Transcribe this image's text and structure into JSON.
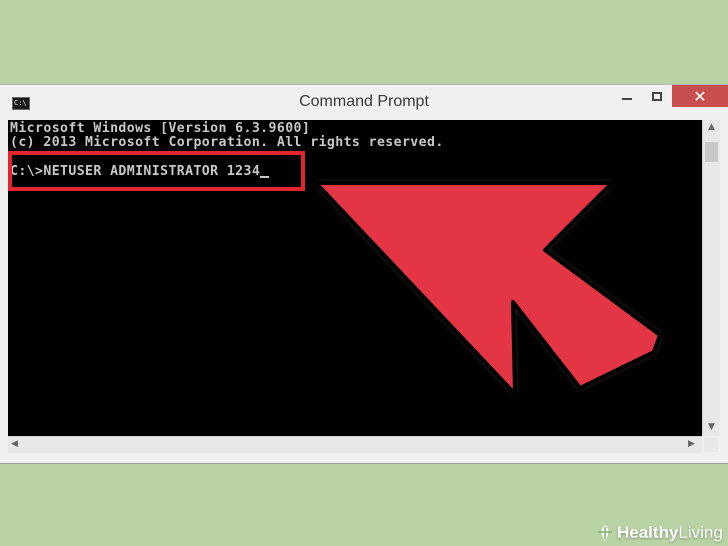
{
  "window": {
    "title": "Command Prompt",
    "icon": "cmd-icon",
    "icon_label": "C:\\",
    "minimize_icon": "minimize-icon",
    "maximize_icon": "maximize-icon",
    "close_icon": "close-icon",
    "close_glyph": "✕"
  },
  "console": {
    "line1": "Microsoft Windows [Version 6.3.9600]",
    "line2": "(c) 2013 Microsoft Corporation. All rights reserved.",
    "prompt": "C:\\>",
    "command": "NETUSER ADMINISTRATOR 1234"
  },
  "annotation": {
    "highlight_color": "#e3262e",
    "arrow_color": "#e33544",
    "arrow_icon": "pointer-arrow-icon"
  },
  "watermark": {
    "brand_bold": "Healthy",
    "brand_light": "Living",
    "icon": "leaf-icon"
  },
  "colors": {
    "background": "#b9d3a4",
    "console_bg": "#000000",
    "console_text": "#c8c8c8",
    "close_button": "#c94f4f"
  }
}
